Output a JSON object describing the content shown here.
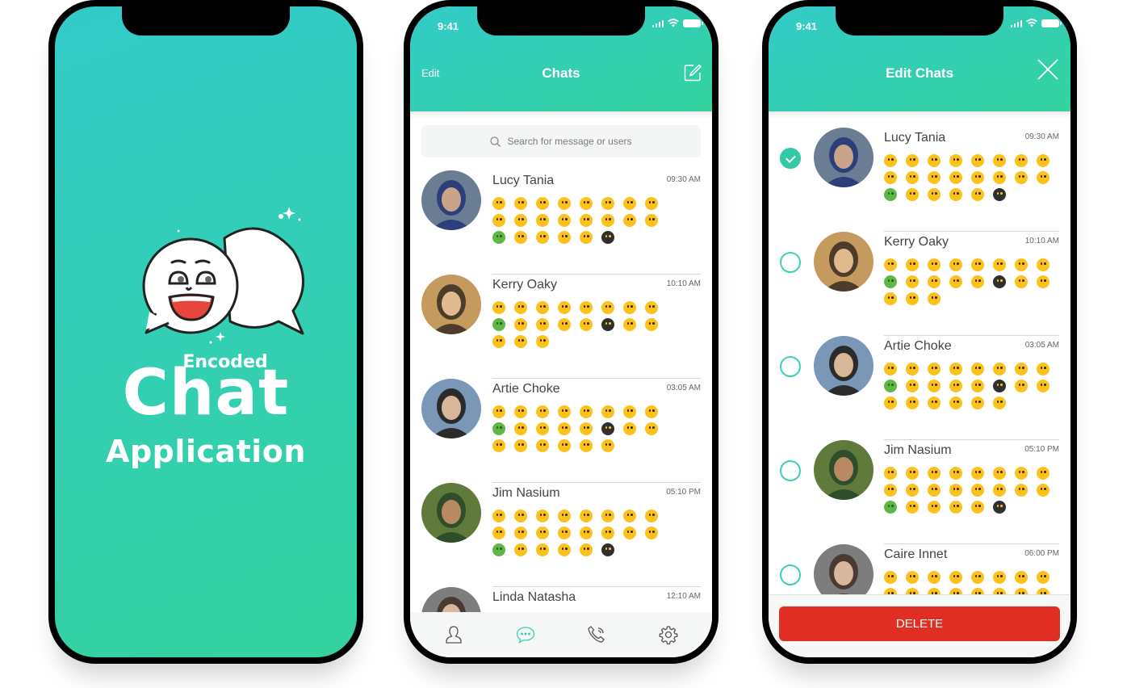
{
  "splash": {
    "brand_top": "Encoded",
    "brand_main": "Chat",
    "brand_bottom": "Application",
    "bg_gradient": [
      "#33cbc9",
      "#33d29e"
    ]
  },
  "status_bar": {
    "time": "9:41"
  },
  "chats_screen": {
    "title": "Chats",
    "edit_label": "Edit",
    "compose_icon": "compose-icon",
    "search": {
      "placeholder": "Search for message or users"
    },
    "chats": [
      {
        "name": "Lucy Tania",
        "time": "09:30 AM",
        "emojis": [
          "y",
          "y",
          "y",
          "y",
          "y",
          "y",
          "y",
          "y",
          "y",
          "y",
          "y",
          "y",
          "y",
          "y",
          "y",
          "y",
          "g",
          "y",
          "y",
          "y",
          "y",
          "k"
        ]
      },
      {
        "name": "Kerry Oaky",
        "time": "10:10 AM",
        "emojis": [
          "y",
          "y",
          "y",
          "y",
          "y",
          "y",
          "y",
          "y",
          "g",
          "y",
          "y",
          "y",
          "y",
          "k",
          "y",
          "y",
          "y",
          "y",
          "y"
        ]
      },
      {
        "name": "Artie Choke",
        "time": "03:05 AM",
        "emojis": [
          "y",
          "y",
          "y",
          "y",
          "y",
          "y",
          "y",
          "y",
          "g",
          "y",
          "y",
          "y",
          "y",
          "k",
          "y",
          "y",
          "y",
          "y",
          "y",
          "y",
          "y",
          "y"
        ]
      },
      {
        "name": "Jim Nasium",
        "time": "05:10 PM",
        "emojis": [
          "y",
          "y",
          "y",
          "y",
          "y",
          "y",
          "y",
          "y",
          "y",
          "y",
          "y",
          "y",
          "y",
          "y",
          "y",
          "y",
          "g",
          "y",
          "y",
          "y",
          "y",
          "k"
        ]
      },
      {
        "name": "Linda Natasha",
        "time": "12:10 AM",
        "emojis": []
      }
    ],
    "tabs": [
      {
        "name": "contacts",
        "icon": "person-icon",
        "active": false
      },
      {
        "name": "chats",
        "icon": "chat-bubble-icon",
        "active": true
      },
      {
        "name": "calls",
        "icon": "phone-icon",
        "active": false
      },
      {
        "name": "settings",
        "icon": "gear-icon",
        "active": false
      }
    ]
  },
  "edit_screen": {
    "title": "Edit Chats",
    "close_icon": "close-icon",
    "delete_label": "DELETE",
    "delete_color": "#e02f22",
    "chats": [
      {
        "name": "Lucy Tania",
        "time": "09:30 AM",
        "selected": true,
        "emojis": [
          "y",
          "y",
          "y",
          "y",
          "y",
          "y",
          "y",
          "y",
          "y",
          "y",
          "y",
          "y",
          "y",
          "y",
          "y",
          "y",
          "g",
          "y",
          "y",
          "y",
          "y",
          "k"
        ]
      },
      {
        "name": "Kerry Oaky",
        "time": "10:10 AM",
        "selected": false,
        "emojis": [
          "y",
          "y",
          "y",
          "y",
          "y",
          "y",
          "y",
          "y",
          "g",
          "y",
          "y",
          "y",
          "y",
          "k",
          "y",
          "y",
          "y",
          "y",
          "y"
        ]
      },
      {
        "name": "Artie Choke",
        "time": "03:05 AM",
        "selected": false,
        "emojis": [
          "y",
          "y",
          "y",
          "y",
          "y",
          "y",
          "y",
          "y",
          "g",
          "y",
          "y",
          "y",
          "y",
          "k",
          "y",
          "y",
          "y",
          "y",
          "y",
          "y",
          "y",
          "y"
        ]
      },
      {
        "name": "Jim Nasium",
        "time": "05:10 PM",
        "selected": false,
        "emojis": [
          "y",
          "y",
          "y",
          "y",
          "y",
          "y",
          "y",
          "y",
          "y",
          "y",
          "y",
          "y",
          "y",
          "y",
          "y",
          "y",
          "g",
          "y",
          "y",
          "y",
          "y",
          "k"
        ]
      },
      {
        "name": "Caire Innet",
        "time": "06:00 PM",
        "selected": false,
        "emojis": [
          "y",
          "y",
          "y",
          "y",
          "y",
          "y",
          "y",
          "y",
          "y",
          "y",
          "y",
          "y",
          "y",
          "y",
          "y",
          "y"
        ]
      }
    ]
  },
  "accent_color": "#33c9a6"
}
